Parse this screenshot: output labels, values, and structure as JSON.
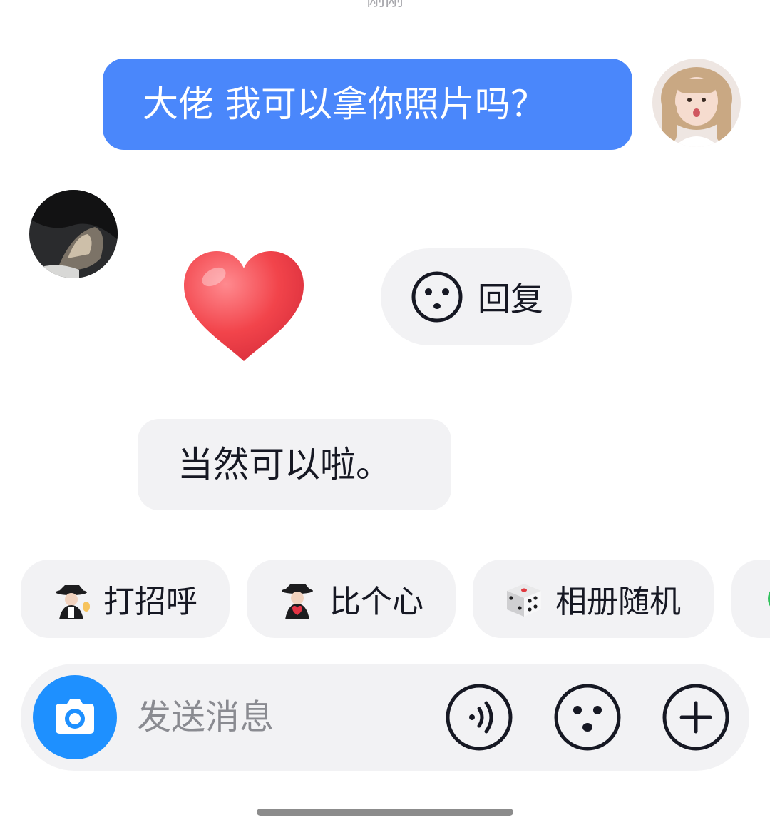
{
  "timestamp": "刚刚",
  "messages": {
    "outgoing_text": "大佬  我可以拿你照片吗？",
    "incoming_text": "当然可以啦。",
    "incoming_sticker": "red-heart"
  },
  "reply_chip": {
    "label": "回复"
  },
  "quick_replies": [
    {
      "label": "打招呼",
      "icon": "waving-figure-emoji"
    },
    {
      "label": "比个心",
      "icon": "heart-figure-emoji"
    },
    {
      "label": "相册随机",
      "icon": "dice-emoji"
    },
    {
      "label": "",
      "icon": "green-circle-emoji"
    }
  ],
  "composer": {
    "placeholder": "发送消息",
    "value": ""
  },
  "colors": {
    "outgoing_bubble": "#4a87fb",
    "bubble_gray": "#f2f2f4",
    "camera_button": "#1e90ff",
    "heart": "#f2444b"
  }
}
